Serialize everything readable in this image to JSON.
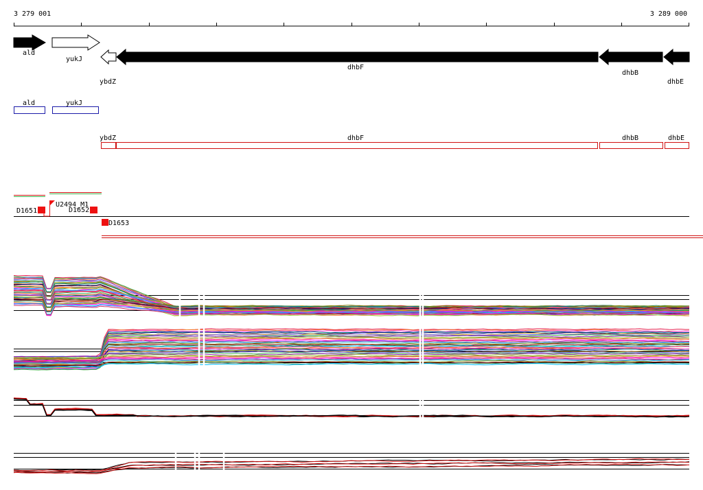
{
  "ruler": {
    "start_label": "3 279 001",
    "end_label": "3 289 000"
  },
  "genes": [
    {
      "id": "ald",
      "label": "ald",
      "strand": "+",
      "style": "filled"
    },
    {
      "id": "yukJ",
      "label": "yukJ",
      "strand": "+",
      "style": "open"
    },
    {
      "id": "ybdZ",
      "label": "ybdZ",
      "strand": "-",
      "style": "open"
    },
    {
      "id": "dhbF",
      "label": "dhbF",
      "strand": "-",
      "style": "filled"
    },
    {
      "id": "dhbB",
      "label": "dhbB",
      "strand": "-",
      "style": "filled"
    },
    {
      "id": "dhbE",
      "label": "dhbE",
      "strand": "-",
      "style": "filled"
    }
  ],
  "annotation_boxes": {
    "plus_strand": [
      {
        "id": "ald",
        "label": "ald"
      },
      {
        "id": "yukJ",
        "label": "yukJ"
      }
    ],
    "minus_strand": [
      {
        "id": "ybdZ",
        "label": "ybdZ"
      },
      {
        "id": "dhbF",
        "label": "dhbF"
      },
      {
        "id": "dhbB",
        "label": "dhbB"
      },
      {
        "id": "dhbE",
        "label": "dhbE"
      }
    ]
  },
  "features": [
    {
      "id": "D1651",
      "label": "D1651"
    },
    {
      "id": "U2494_M1",
      "label": "U2494_M1"
    },
    {
      "id": "D1652",
      "label": "D1652"
    },
    {
      "id": "D1653",
      "label": "D1653"
    }
  ],
  "colors": {
    "gene_arrow": "#000000",
    "plus_box": "#1a1aa8",
    "minus_box": "#d01010",
    "feature": "#ee1111",
    "track_line": "#000000",
    "signal_palette": [
      "#e6194b",
      "#3cb44b",
      "#4363d8",
      "#f58231",
      "#911eb4",
      "#46c0d0",
      "#f032e6",
      "#9acd32",
      "#808000",
      "#008080",
      "#aa6e28",
      "#800000",
      "#000075",
      "#ff7f50",
      "#2e8b57",
      "#daa520",
      "#ff00ff",
      "#00bfff",
      "#7b68ee",
      "#cc3366"
    ]
  }
}
